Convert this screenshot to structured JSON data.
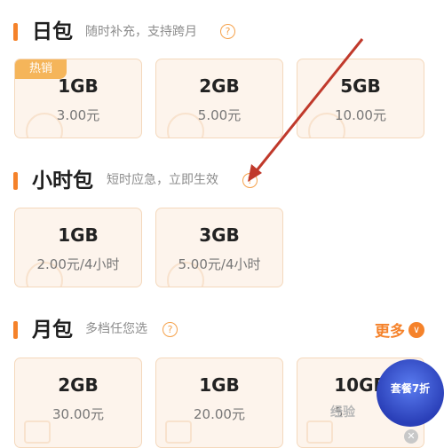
{
  "sections": {
    "daily": {
      "title": "日包",
      "subtitle": "随时补充，支持跨月",
      "cards": [
        {
          "size": "1GB",
          "price": "3.00元",
          "badge": "热销"
        },
        {
          "size": "2GB",
          "price": "5.00元"
        },
        {
          "size": "5GB",
          "price": "10.00元"
        }
      ]
    },
    "hourly": {
      "title": "小时包",
      "subtitle": "短时应急，立即生效",
      "cards": [
        {
          "size": "1GB",
          "price": "2.00元/4小时"
        },
        {
          "size": "3GB",
          "price": "5.00元/4小时"
        }
      ]
    },
    "monthly": {
      "title": "月包",
      "subtitle": "多档任您选",
      "more_label": "更多",
      "cards": [
        {
          "size": "2GB",
          "price": "30.00元"
        },
        {
          "size": "1GB",
          "price": "20.00元"
        },
        {
          "size": "10GB",
          "price": "5"
        }
      ]
    }
  },
  "promo": {
    "label": "套餐7折"
  },
  "watermark": "经验",
  "colors": {
    "accent": "#f5822a",
    "card_bg": "#fdf4ec",
    "card_border": "#f4d8bc",
    "annotation_arrow": "#c0392b"
  },
  "icons": {
    "help": "question-circle-icon",
    "more": "chevron-down-icon",
    "close": "close-icon"
  }
}
